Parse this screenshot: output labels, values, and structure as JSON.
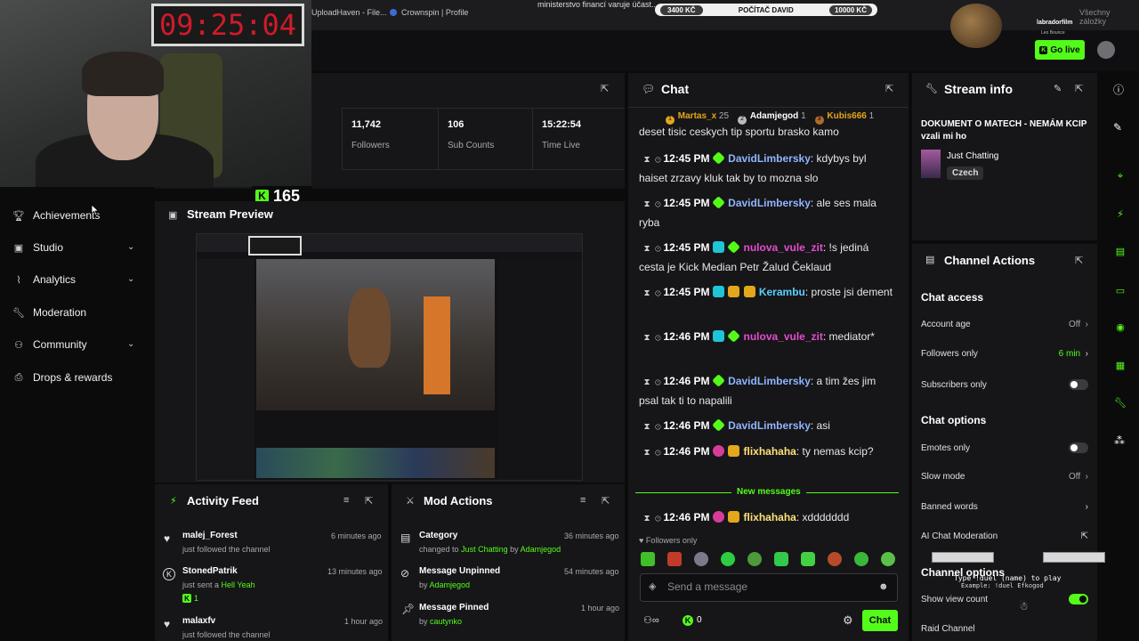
{
  "browser": {
    "tabs": [
      "UploadHaven - File...",
      "Crownspin | Profile"
    ],
    "bookmarks_right": "Všechny záložky",
    "ticker": "ministerstvo financí varuje účast...",
    "kc_bar": {
      "left": "3400 KČ",
      "center": "POČÍTAČ DAVID",
      "right": "10000 KČ"
    }
  },
  "overlay": {
    "timer": "09:25:04",
    "follower_goal": "165",
    "streamer_name": "labradorfilm",
    "streamer_sub": "Leo Bounce"
  },
  "header": {
    "go_live_label": "Go live"
  },
  "sidebar": {
    "items": [
      {
        "label": "Achievements",
        "icon": "trophy-icon",
        "has_chevron": false
      },
      {
        "label": "Studio",
        "icon": "studio-icon",
        "has_chevron": true
      },
      {
        "label": "Analytics",
        "icon": "analytics-icon",
        "has_chevron": true
      },
      {
        "label": "Moderation",
        "icon": "wrench-icon",
        "has_chevron": false
      },
      {
        "label": "Community",
        "icon": "community-icon",
        "has_chevron": true
      },
      {
        "label": "Drops & rewards",
        "icon": "drops-icon",
        "has_chevron": false
      }
    ]
  },
  "stats": [
    {
      "value": "11,742",
      "label": "Followers"
    },
    {
      "value": "106",
      "label": "Sub Counts"
    },
    {
      "value": "15:22:54",
      "label": "Time Live"
    }
  ],
  "preview": {
    "title": "Stream Preview"
  },
  "chat": {
    "title": "Chat",
    "top_gifters": [
      {
        "rank": "1",
        "name": "Martas_x",
        "count": "25"
      },
      {
        "rank": "2",
        "name": "Adamjegod",
        "count": "1"
      },
      {
        "rank": "3",
        "name": "Kubis666",
        "count": "1"
      }
    ],
    "partial_line": "deset tisic ceskych tip sportu brasko kamo",
    "messages": [
      {
        "time": "12:45 PM",
        "badges": [
          "green"
        ],
        "user": "DavidLimbersky",
        "color": "#8fb4ff",
        "text": "kdybys byl haiset zrzavy kluk tak by to mozna slo"
      },
      {
        "time": "12:45 PM",
        "badges": [
          "green"
        ],
        "user": "DavidLimbersky",
        "color": "#8fb4ff",
        "text": "ale ses mala ryba"
      },
      {
        "time": "12:45 PM",
        "badges": [
          "cyan",
          "green"
        ],
        "user": "nulova_vule_zit",
        "color": "#e54bd0",
        "text": "!s jediná cesta je Kick Median Petr Žalud Čeklaud"
      },
      {
        "time": "12:45 PM",
        "badges": [
          "cyan",
          "gold",
          "gold"
        ],
        "user": "Kerambu",
        "color": "#5ad0ff",
        "text": "proste jsi dement"
      },
      {
        "time": "12:46 PM",
        "badges": [
          "cyan",
          "green"
        ],
        "user": "nulova_vule_zit",
        "color": "#e54bd0",
        "text": "mediator*"
      },
      {
        "time": "12:46 PM",
        "badges": [
          "green"
        ],
        "user": "DavidLimbersky",
        "color": "#8fb4ff",
        "text": "a tim žes jim psal tak ti to napalili"
      },
      {
        "time": "12:46 PM",
        "badges": [
          "green"
        ],
        "user": "DavidLimbersky",
        "color": "#8fb4ff",
        "text": "asi"
      },
      {
        "time": "12:46 PM",
        "badges": [
          "pink",
          "gold"
        ],
        "user": "flixhahaha",
        "color": "#ffe07a",
        "text": "ty nemas kcip?"
      }
    ],
    "new_messages_label": "New messages",
    "last_message": {
      "time": "12:46 PM",
      "badges": [
        "pink",
        "gold"
      ],
      "user": "flixhahaha",
      "color": "#ffe07a",
      "text": "xddddddd"
    },
    "followers_only_label": "Followers only",
    "input_placeholder": "Send a message",
    "send_label": "Chat",
    "kick_count": "0"
  },
  "stream_info": {
    "title": "Stream info",
    "stream_title": "DOKUMENT O MATECH - NEMÁM KCIP vzali mi ho",
    "category": "Just Chatting",
    "language": "Czech"
  },
  "channel_actions": {
    "title": "Channel Actions",
    "chat_access_label": "Chat access",
    "account_age": {
      "label": "Account age",
      "value": "Off"
    },
    "followers_only": {
      "label": "Followers only",
      "value": "6 min"
    },
    "subscribers_only": {
      "label": "Subscribers only"
    },
    "chat_options_label": "Chat options",
    "emotes_only": {
      "label": "Emotes only"
    },
    "slow_mode": {
      "label": "Slow mode",
      "value": "Off"
    },
    "banned_words": {
      "label": "Banned words"
    },
    "ai_moderation": {
      "label": "AI Chat Moderation"
    },
    "channel_options_label": "Channel options",
    "show_view_count": {
      "label": "Show view count"
    },
    "raid_channel": {
      "label": "Raid Channel"
    }
  },
  "duel_overlay": {
    "line1": "Type !duel (name) to play",
    "line2": "Example: !duel Efkogod"
  },
  "activity_feed": {
    "title": "Activity Feed",
    "items": [
      {
        "name": "malej_Forest",
        "sub": "just followed the channel",
        "time": "6 minutes ago",
        "icon": "heart-icon"
      },
      {
        "name": "StonedPatrik",
        "sub": "just sent a",
        "sub_highlight": "Hell Yeah",
        "kicks": "1",
        "time": "13 minutes ago",
        "icon": "kick-icon"
      },
      {
        "name": "malaxfv",
        "sub": "just followed the channel",
        "time": "1 hour ago",
        "icon": "heart-icon"
      }
    ]
  },
  "mod_actions": {
    "title": "Mod Actions",
    "items": [
      {
        "title": "Category",
        "sub_pre": "changed to",
        "sub_a": "Just Chatting",
        "sub_mid": "by",
        "sub_b": "Adamjegod",
        "time": "36 minutes ago",
        "icon": "category-icon"
      },
      {
        "title": "Message Unpinned",
        "sub_mid": "by",
        "sub_b": "Adamjegod",
        "time": "54 minutes ago",
        "icon": "unpin-icon"
      },
      {
        "title": "Message Pinned",
        "sub_mid": "by",
        "sub_b": "cautynko",
        "time": "1 hour ago",
        "icon": "pin-icon"
      }
    ]
  },
  "colors": {
    "accent": "#53fc18",
    "panel": "#161618",
    "background": "#0b0b0c"
  }
}
